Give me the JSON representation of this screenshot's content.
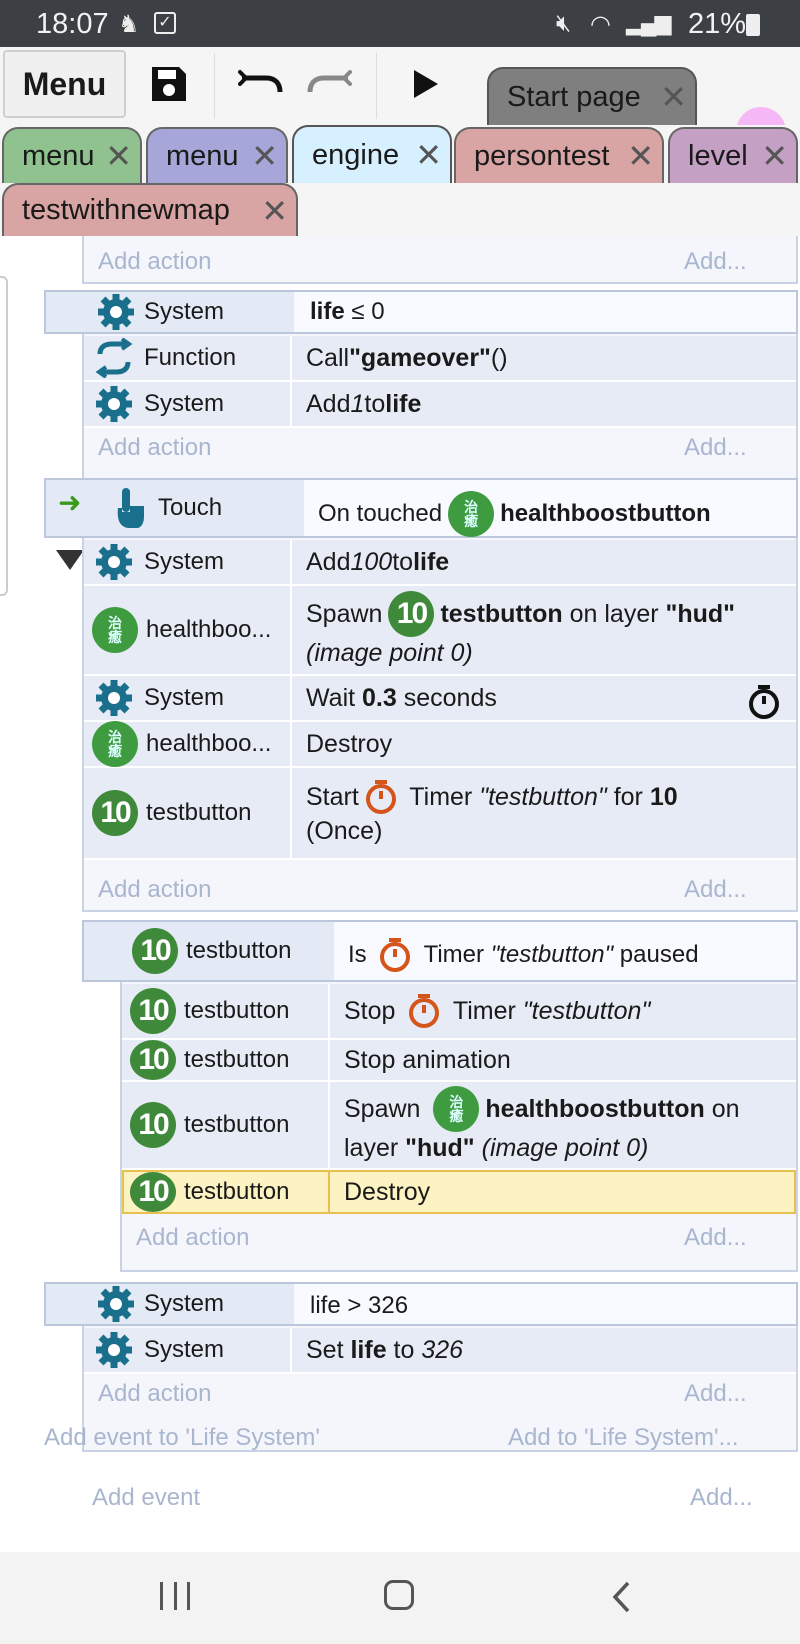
{
  "status": {
    "time": "18:07",
    "battery": "21%"
  },
  "toolbar": {
    "menu_label": "Menu"
  },
  "tabs_row1": [
    {
      "label": "Start page",
      "color": "#7f7f7f"
    }
  ],
  "tabs_row2": [
    {
      "label": "menu",
      "color": "#8fc28f"
    },
    {
      "label": "menu",
      "color": "#a6a6d9"
    },
    {
      "label": "engine",
      "color": "#d6f0ff"
    },
    {
      "label": "persontest",
      "color": "#d8a4a4"
    },
    {
      "label": "level",
      "color": "#c5a0c5"
    }
  ],
  "tabs_row3": [
    {
      "label": "testwithnewmap",
      "color": "#d8a4a4"
    }
  ],
  "sheet": {
    "add_action": "Add action",
    "add_more": "Add...",
    "ev1": {
      "cond_obj": "System",
      "cond_text": "life",
      "cond_op": " ≤ 0",
      "actions": [
        {
          "obj": "Function",
          "a": "Call ",
          "b": "\"gameover\"",
          "c": " ()"
        },
        {
          "obj": "System",
          "a": "Add ",
          "b": "1",
          "c": " to ",
          "d": "life"
        }
      ]
    },
    "ev2": {
      "cond_obj": "Touch",
      "cond_a": "On touched ",
      "cond_b": "healthboostbutton",
      "actions": [
        {
          "obj": "System",
          "a": "Add ",
          "b": "100",
          "c": " to ",
          "d": "life"
        },
        {
          "obj": "healthboo...",
          "a": "Spawn ",
          "b": "testbutton",
          "c": " on layer ",
          "d": "\"hud\"",
          "e": "(image point 0)"
        },
        {
          "obj": "System",
          "a": "Wait ",
          "b": "0.3",
          "c": " seconds"
        },
        {
          "obj": "healthboo...",
          "a": "Destroy"
        },
        {
          "obj": "testbutton",
          "a": "Start ",
          "b": " Timer ",
          "c": "\"testbutton\"",
          "d": " for ",
          "e": "10",
          "f": "(Once)"
        }
      ]
    },
    "ev3": {
      "cond_obj": "testbutton",
      "cond_a": "Is ",
      "cond_b": " Timer ",
      "cond_c": "\"testbutton\"",
      "cond_d": " paused",
      "actions": [
        {
          "obj": "testbutton",
          "a": "Stop ",
          "b": " Timer ",
          "c": "\"testbutton\""
        },
        {
          "obj": "testbutton",
          "a": "Stop animation"
        },
        {
          "obj": "testbutton",
          "a": "Spawn ",
          "b": "healthboostbutton",
          "c": " on",
          "d": "layer ",
          "e": "\"hud\"",
          "f": " (image point 0)"
        },
        {
          "obj": "testbutton",
          "a": "Destroy"
        }
      ]
    },
    "ev4": {
      "cond_obj": "System",
      "cond_text": "life > 326",
      "actions": [
        {
          "obj": "System",
          "a": "Set ",
          "b": "life",
          "c": " to ",
          "d": "326"
        }
      ]
    },
    "add_event_group": "Add event to 'Life System'",
    "add_to_group": "Add to 'Life System'...",
    "add_event": "Add event",
    "add_more2": "Add..."
  }
}
